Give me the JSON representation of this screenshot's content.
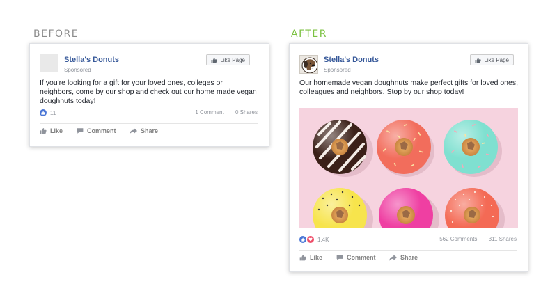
{
  "before": {
    "label": "BEFORE",
    "post": {
      "page_name": "Stella's Donuts",
      "sponsored": "Sponsored",
      "like_page": "Like Page",
      "text": "If you're looking for a gift for your loved ones, colleges or neighbors, come by our shop and check out our home made vegan doughnuts today!",
      "reaction_count": "11",
      "comments": "1 Comment",
      "shares": "0 Shares",
      "actions": {
        "like": "Like",
        "comment": "Comment",
        "share": "Share"
      }
    }
  },
  "after": {
    "label": "AFTER",
    "post": {
      "page_name": "Stella's Donuts",
      "sponsored": "Sponsored",
      "like_page": "Like Page",
      "text": "Our homemade vegan doughnuts make perfect gifts for loved ones, colleagues and neighbors. Stop by our shop today!",
      "reaction_count": "1.4K",
      "comments": "562 Comments",
      "shares": "311 Shares",
      "actions": {
        "like": "Like",
        "comment": "Comment",
        "share": "Share"
      }
    }
  },
  "colors": {
    "before_label": "#8c8c8c",
    "after_label": "#7cc242",
    "link": "#365899",
    "like_blue": "#4a76d6",
    "love_red": "#ee4b67",
    "photo_bg": "#f6d3df"
  },
  "icons": [
    "thumbs-up-icon",
    "comment-icon",
    "share-arrow-icon",
    "heart-icon",
    "dog-avatar-icon"
  ]
}
